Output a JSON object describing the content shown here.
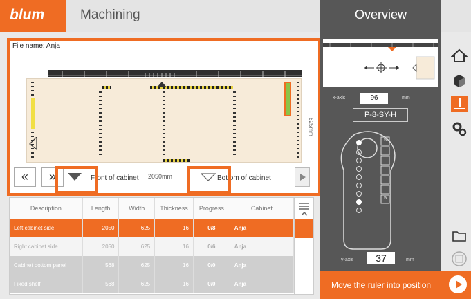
{
  "header": {
    "logo": "blum",
    "title": "Machining",
    "panel_title": "Overview"
  },
  "preview": {
    "file_name": "File name: Anja",
    "side_dimension": "625mm",
    "width_dimension": "2050mm",
    "front_label": "Front of cabinet",
    "bottom_label": "Bottom of cabinet",
    "nav_prev_all": "«",
    "nav_next": "»"
  },
  "table": {
    "columns": [
      "Description",
      "Length",
      "Width",
      "Thickness",
      "Progress",
      "Cabinet"
    ],
    "rows": [
      {
        "description": "Left cabinet side",
        "length": "2050",
        "width": "625",
        "thickness": "16",
        "progress": "0/8",
        "cabinet": "Anja"
      },
      {
        "description": "Right cabinet side",
        "length": "2050",
        "width": "625",
        "thickness": "16",
        "progress": "0/6",
        "cabinet": "Anja"
      },
      {
        "description": "Cabinet bottom panel",
        "length": "568",
        "width": "625",
        "thickness": "16",
        "progress": "0/0",
        "cabinet": "Anja"
      },
      {
        "description": "Fixed shelf",
        "length": "568",
        "width": "625",
        "thickness": "16",
        "progress": "0/0",
        "cabinet": "Anja"
      }
    ]
  },
  "panel": {
    "x_label": "x-axis",
    "x_value": "96",
    "x_unit": "mm",
    "code": "P-8-SY-H",
    "slot_a": "5",
    "slot_b": "5",
    "y_label": "y-axis",
    "y_value": "37",
    "y_unit": "mm"
  },
  "status": {
    "message": "Move the ruler into position"
  },
  "colors": {
    "accent": "#ef6c23",
    "panel": "#575757"
  }
}
